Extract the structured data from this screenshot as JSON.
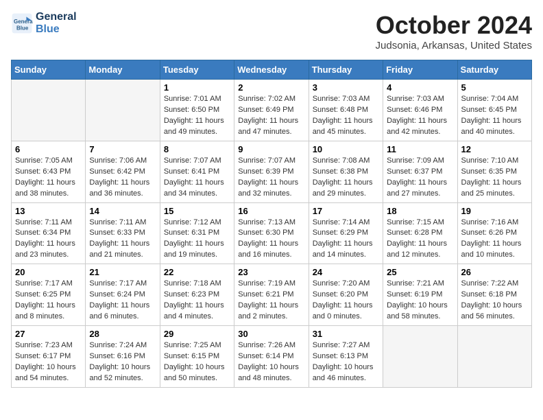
{
  "header": {
    "logo_line1": "General",
    "logo_line2": "Blue",
    "month": "October 2024",
    "location": "Judsonia, Arkansas, United States"
  },
  "weekdays": [
    "Sunday",
    "Monday",
    "Tuesday",
    "Wednesday",
    "Thursday",
    "Friday",
    "Saturday"
  ],
  "weeks": [
    [
      {
        "day": "",
        "sunrise": "",
        "sunset": "",
        "daylight": ""
      },
      {
        "day": "",
        "sunrise": "",
        "sunset": "",
        "daylight": ""
      },
      {
        "day": "1",
        "sunrise": "Sunrise: 7:01 AM",
        "sunset": "Sunset: 6:50 PM",
        "daylight": "Daylight: 11 hours and 49 minutes."
      },
      {
        "day": "2",
        "sunrise": "Sunrise: 7:02 AM",
        "sunset": "Sunset: 6:49 PM",
        "daylight": "Daylight: 11 hours and 47 minutes."
      },
      {
        "day": "3",
        "sunrise": "Sunrise: 7:03 AM",
        "sunset": "Sunset: 6:48 PM",
        "daylight": "Daylight: 11 hours and 45 minutes."
      },
      {
        "day": "4",
        "sunrise": "Sunrise: 7:03 AM",
        "sunset": "Sunset: 6:46 PM",
        "daylight": "Daylight: 11 hours and 42 minutes."
      },
      {
        "day": "5",
        "sunrise": "Sunrise: 7:04 AM",
        "sunset": "Sunset: 6:45 PM",
        "daylight": "Daylight: 11 hours and 40 minutes."
      }
    ],
    [
      {
        "day": "6",
        "sunrise": "Sunrise: 7:05 AM",
        "sunset": "Sunset: 6:43 PM",
        "daylight": "Daylight: 11 hours and 38 minutes."
      },
      {
        "day": "7",
        "sunrise": "Sunrise: 7:06 AM",
        "sunset": "Sunset: 6:42 PM",
        "daylight": "Daylight: 11 hours and 36 minutes."
      },
      {
        "day": "8",
        "sunrise": "Sunrise: 7:07 AM",
        "sunset": "Sunset: 6:41 PM",
        "daylight": "Daylight: 11 hours and 34 minutes."
      },
      {
        "day": "9",
        "sunrise": "Sunrise: 7:07 AM",
        "sunset": "Sunset: 6:39 PM",
        "daylight": "Daylight: 11 hours and 32 minutes."
      },
      {
        "day": "10",
        "sunrise": "Sunrise: 7:08 AM",
        "sunset": "Sunset: 6:38 PM",
        "daylight": "Daylight: 11 hours and 29 minutes."
      },
      {
        "day": "11",
        "sunrise": "Sunrise: 7:09 AM",
        "sunset": "Sunset: 6:37 PM",
        "daylight": "Daylight: 11 hours and 27 minutes."
      },
      {
        "day": "12",
        "sunrise": "Sunrise: 7:10 AM",
        "sunset": "Sunset: 6:35 PM",
        "daylight": "Daylight: 11 hours and 25 minutes."
      }
    ],
    [
      {
        "day": "13",
        "sunrise": "Sunrise: 7:11 AM",
        "sunset": "Sunset: 6:34 PM",
        "daylight": "Daylight: 11 hours and 23 minutes."
      },
      {
        "day": "14",
        "sunrise": "Sunrise: 7:11 AM",
        "sunset": "Sunset: 6:33 PM",
        "daylight": "Daylight: 11 hours and 21 minutes."
      },
      {
        "day": "15",
        "sunrise": "Sunrise: 7:12 AM",
        "sunset": "Sunset: 6:31 PM",
        "daylight": "Daylight: 11 hours and 19 minutes."
      },
      {
        "day": "16",
        "sunrise": "Sunrise: 7:13 AM",
        "sunset": "Sunset: 6:30 PM",
        "daylight": "Daylight: 11 hours and 16 minutes."
      },
      {
        "day": "17",
        "sunrise": "Sunrise: 7:14 AM",
        "sunset": "Sunset: 6:29 PM",
        "daylight": "Daylight: 11 hours and 14 minutes."
      },
      {
        "day": "18",
        "sunrise": "Sunrise: 7:15 AM",
        "sunset": "Sunset: 6:28 PM",
        "daylight": "Daylight: 11 hours and 12 minutes."
      },
      {
        "day": "19",
        "sunrise": "Sunrise: 7:16 AM",
        "sunset": "Sunset: 6:26 PM",
        "daylight": "Daylight: 11 hours and 10 minutes."
      }
    ],
    [
      {
        "day": "20",
        "sunrise": "Sunrise: 7:17 AM",
        "sunset": "Sunset: 6:25 PM",
        "daylight": "Daylight: 11 hours and 8 minutes."
      },
      {
        "day": "21",
        "sunrise": "Sunrise: 7:17 AM",
        "sunset": "Sunset: 6:24 PM",
        "daylight": "Daylight: 11 hours and 6 minutes."
      },
      {
        "day": "22",
        "sunrise": "Sunrise: 7:18 AM",
        "sunset": "Sunset: 6:23 PM",
        "daylight": "Daylight: 11 hours and 4 minutes."
      },
      {
        "day": "23",
        "sunrise": "Sunrise: 7:19 AM",
        "sunset": "Sunset: 6:21 PM",
        "daylight": "Daylight: 11 hours and 2 minutes."
      },
      {
        "day": "24",
        "sunrise": "Sunrise: 7:20 AM",
        "sunset": "Sunset: 6:20 PM",
        "daylight": "Daylight: 11 hours and 0 minutes."
      },
      {
        "day": "25",
        "sunrise": "Sunrise: 7:21 AM",
        "sunset": "Sunset: 6:19 PM",
        "daylight": "Daylight: 10 hours and 58 minutes."
      },
      {
        "day": "26",
        "sunrise": "Sunrise: 7:22 AM",
        "sunset": "Sunset: 6:18 PM",
        "daylight": "Daylight: 10 hours and 56 minutes."
      }
    ],
    [
      {
        "day": "27",
        "sunrise": "Sunrise: 7:23 AM",
        "sunset": "Sunset: 6:17 PM",
        "daylight": "Daylight: 10 hours and 54 minutes."
      },
      {
        "day": "28",
        "sunrise": "Sunrise: 7:24 AM",
        "sunset": "Sunset: 6:16 PM",
        "daylight": "Daylight: 10 hours and 52 minutes."
      },
      {
        "day": "29",
        "sunrise": "Sunrise: 7:25 AM",
        "sunset": "Sunset: 6:15 PM",
        "daylight": "Daylight: 10 hours and 50 minutes."
      },
      {
        "day": "30",
        "sunrise": "Sunrise: 7:26 AM",
        "sunset": "Sunset: 6:14 PM",
        "daylight": "Daylight: 10 hours and 48 minutes."
      },
      {
        "day": "31",
        "sunrise": "Sunrise: 7:27 AM",
        "sunset": "Sunset: 6:13 PM",
        "daylight": "Daylight: 10 hours and 46 minutes."
      },
      {
        "day": "",
        "sunrise": "",
        "sunset": "",
        "daylight": ""
      },
      {
        "day": "",
        "sunrise": "",
        "sunset": "",
        "daylight": ""
      }
    ]
  ]
}
